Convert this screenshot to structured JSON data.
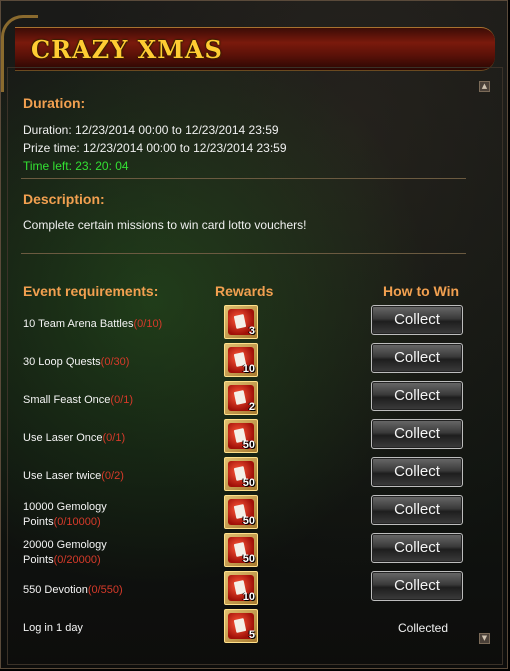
{
  "window": {
    "title": "CRAZY XMAS"
  },
  "duration": {
    "heading": "Duration:",
    "duration_line": "Duration: 12/23/2014 00:00 to 12/23/2014 23:59",
    "prize_line": "Prize time: 12/23/2014 00:00 to 12/23/2014 23:59",
    "time_left": "Time left: 23: 20: 04"
  },
  "description": {
    "heading": "Description:",
    "text": "Complete certain missions to win card lotto vouchers!"
  },
  "table": {
    "col_requirements": "Event requirements:",
    "col_rewards": "Rewards",
    "col_how": "How to Win",
    "rows": [
      {
        "label": "10 Team Arena Battles",
        "label2": "",
        "progress": "(0/10)",
        "qty": "3",
        "action": "Collect"
      },
      {
        "label": "30 Loop Quests",
        "label2": "",
        "progress": "(0/30)",
        "qty": "10",
        "action": "Collect"
      },
      {
        "label": "Small Feast Once",
        "label2": "",
        "progress": "(0/1)",
        "qty": "2",
        "action": "Collect"
      },
      {
        "label": "Use Laser Once",
        "label2": "",
        "progress": "(0/1)",
        "qty": "50",
        "action": "Collect"
      },
      {
        "label": "Use Laser twice",
        "label2": "",
        "progress": "(0/2)",
        "qty": "50",
        "action": "Collect"
      },
      {
        "label": "10000 Gemology",
        "label2": "Points",
        "progress": "(0/10000)",
        "qty": "50",
        "action": "Collect"
      },
      {
        "label": "20000 Gemology",
        "label2": "Points",
        "progress": "(0/20000)",
        "qty": "50",
        "action": "Collect"
      },
      {
        "label": "550 Devotion",
        "label2": "",
        "progress": "(0/550)",
        "qty": "10",
        "action": "Collect"
      },
      {
        "label": "Log in 1 day",
        "label2": "",
        "progress": "",
        "qty": "5",
        "action": "Collected"
      }
    ]
  },
  "scrollbar": {
    "up_icon": "arrow-up-icon",
    "down_icon": "arrow-down-icon"
  },
  "colors": {
    "accent": "#f2a050",
    "progress": "#d63a2a",
    "time_left": "#33e033",
    "title": "#ffcc33"
  }
}
